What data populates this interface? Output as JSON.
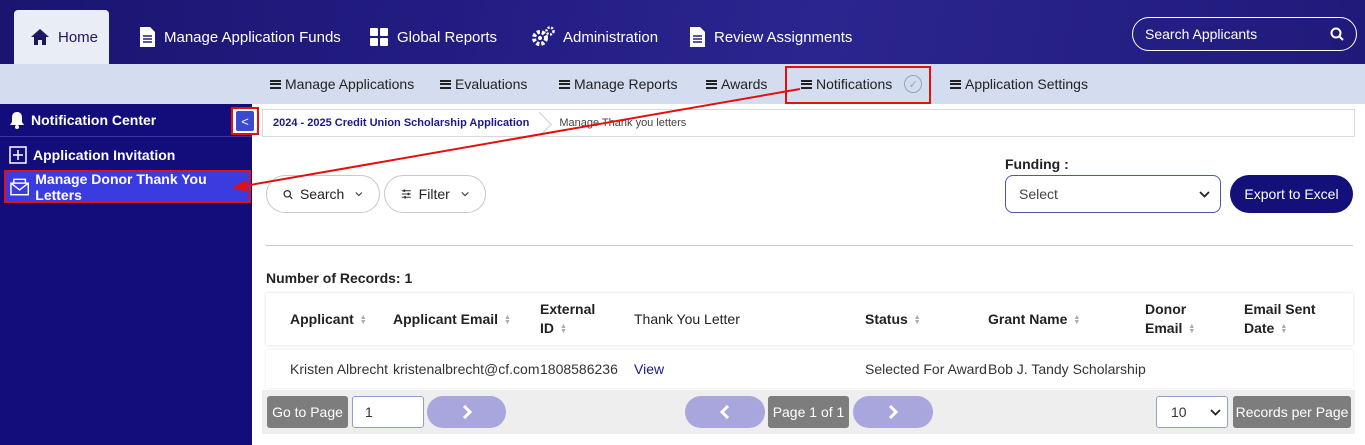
{
  "top_nav": {
    "tabs": [
      {
        "label": "Home",
        "icon": "home-icon"
      },
      {
        "label": "Manage Application Funds",
        "icon": "document-icon"
      },
      {
        "label": "Global Reports",
        "icon": "grid-icon"
      },
      {
        "label": "Administration",
        "icon": "gears-icon"
      },
      {
        "label": "Review Assignments",
        "icon": "document-icon"
      }
    ],
    "search_placeholder": "Search Applicants"
  },
  "sub_nav": {
    "items": [
      {
        "label": "Manage Applications"
      },
      {
        "label": "Evaluations"
      },
      {
        "label": "Manage Reports"
      },
      {
        "label": "Awards"
      },
      {
        "label": "Notifications"
      },
      {
        "label": "Application Settings"
      }
    ]
  },
  "sidebar": {
    "items": [
      {
        "label": "Notification Center",
        "icon": "bell-icon"
      },
      {
        "label": "Application Invitation",
        "icon": "plus-box-icon"
      },
      {
        "label": "Manage Donor Thank You Letters",
        "icon": "envelope-icon"
      }
    ],
    "collapse_symbol": "<"
  },
  "breadcrumb": {
    "items": [
      "2024 - 2025 Credit Union Scholarship Application",
      "Manage Thank you letters"
    ]
  },
  "toolbar": {
    "search_label": "Search",
    "filter_label": "Filter",
    "funding_label": "Funding :",
    "funding_value": "Select",
    "export_label": "Export to Excel"
  },
  "records_label": "Number of Records: 1",
  "table": {
    "headers": [
      [
        "Applicant"
      ],
      [
        "Applicant Email"
      ],
      [
        "External",
        "ID"
      ],
      [
        "Thank You Letter"
      ],
      [
        "Status"
      ],
      [
        "Grant Name"
      ],
      [
        "Donor",
        "Email"
      ],
      [
        "Email Sent",
        "Date"
      ]
    ],
    "rows": [
      [
        "Kristen Albrecht",
        "kristenalbrecht@cf.com",
        "1808586236",
        "View",
        "Selected For Award",
        "Bob J. Tandy Scholarship",
        "",
        ""
      ]
    ]
  },
  "pager": {
    "go_to_page_label": "Go to Page",
    "page_input_value": "1",
    "page_status": "Page 1 of 1",
    "records_per_page_value": "10",
    "records_per_page_label": "Records per Page"
  },
  "colors": {
    "nav_bg": "#1f1a80",
    "subnav_bg": "#d3ddef",
    "sidebar_bg": "#120d7a",
    "accent_button": "#13107a",
    "annotation_red": "#e31010"
  }
}
